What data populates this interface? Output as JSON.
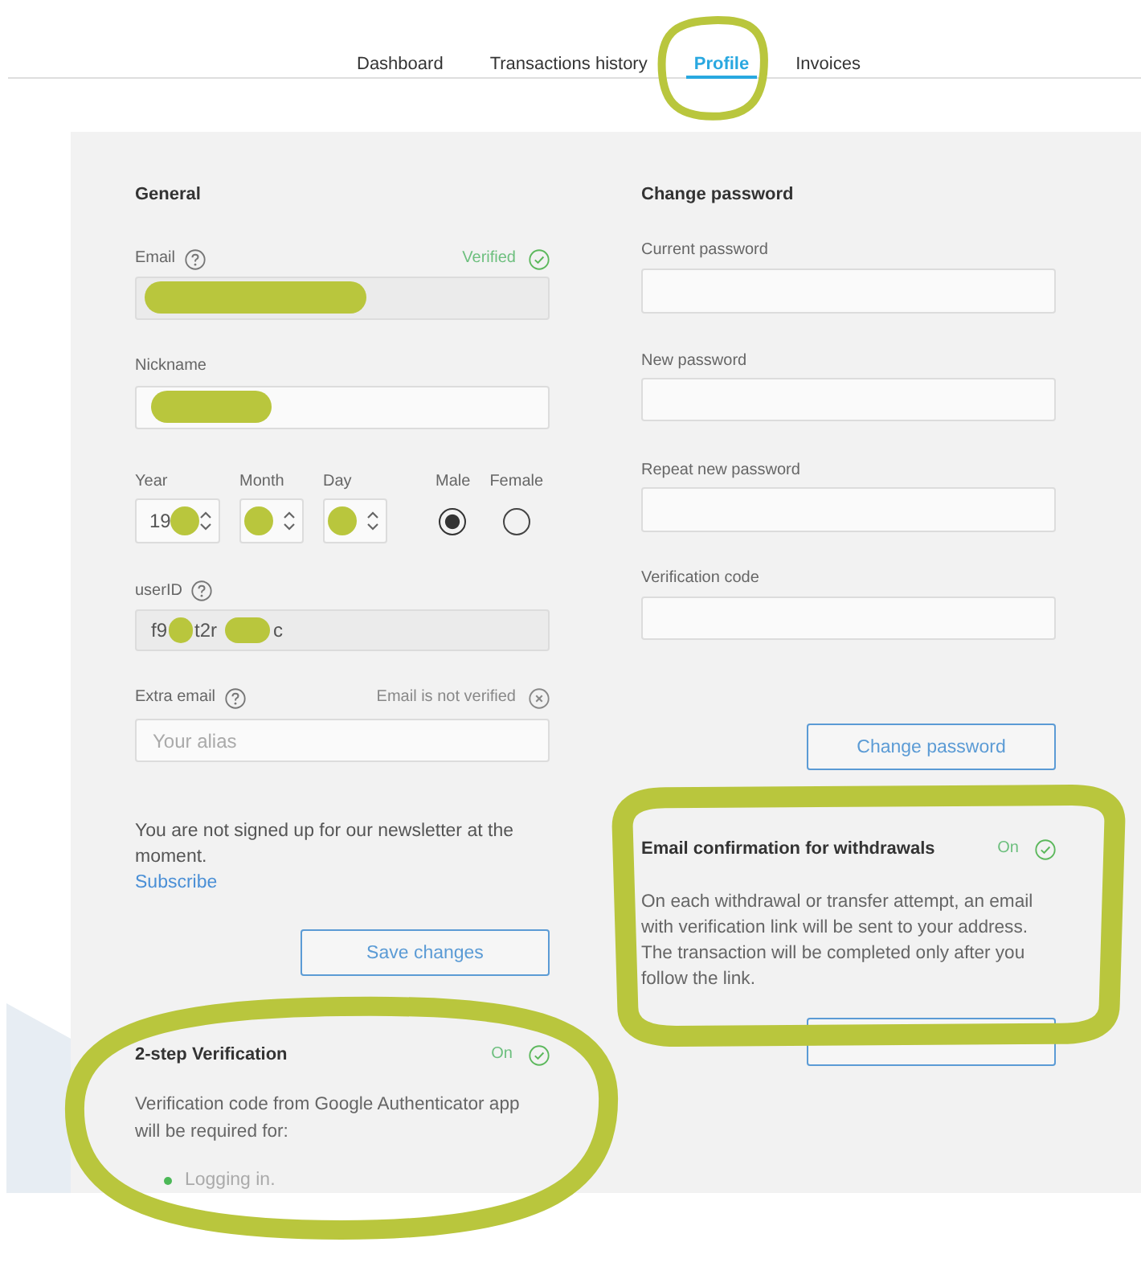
{
  "nav": {
    "tabs": [
      {
        "label": "Dashboard",
        "selected": false,
        "circled": false
      },
      {
        "label": "Transactions history",
        "selected": false,
        "circled": false
      },
      {
        "label": "Profile",
        "selected": true,
        "circled": true
      },
      {
        "label": "Invoices",
        "selected": false,
        "circled": false
      }
    ]
  },
  "general": {
    "title": "General",
    "email": {
      "label": "Email",
      "help": true,
      "status": "Verified",
      "verified": true,
      "redacted": true
    },
    "nickname": {
      "label": "Nickname",
      "redacted": true
    },
    "birth_date": [
      {
        "label": "Year",
        "value": "19",
        "redacted": true
      },
      {
        "label": "Month",
        "redacted": true
      },
      {
        "label": "Day",
        "redacted": true
      }
    ],
    "gender": [
      {
        "label": "Male",
        "selected": true
      },
      {
        "label": "Female",
        "selected": false
      }
    ],
    "user_id": {
      "label": "userID",
      "help": true,
      "value_parts": [
        "f9",
        "t2r",
        "c"
      ]
    },
    "extra_email": {
      "label": "Extra email",
      "help": true,
      "status": "Email is not verified",
      "verified": false,
      "placeholder": "Your alias"
    },
    "newsletter": {
      "text": "You are not signed up for our newsletter at the moment.",
      "link": "Subscribe"
    },
    "save_button": "Save changes"
  },
  "change_password": {
    "title": "Change password",
    "fields": [
      {
        "label": "Current password"
      },
      {
        "label": "New password"
      },
      {
        "label": "Repeat new password"
      },
      {
        "label": "Verification code"
      }
    ],
    "button": "Change password"
  },
  "email_confirmation": {
    "title": "Email confirmation for withdrawals",
    "status": "On",
    "on": true,
    "circled": true,
    "description": "On each withdrawal or transfer attempt, an email with verification link will be sent to your address. The transaction will be completed only after you follow the link."
  },
  "two_step": {
    "title": "2-step Verification",
    "status": "On",
    "on": true,
    "circled": true,
    "description": "Verification code from Google Authenticator app will be required for:",
    "items": [
      "Logging in."
    ]
  }
}
